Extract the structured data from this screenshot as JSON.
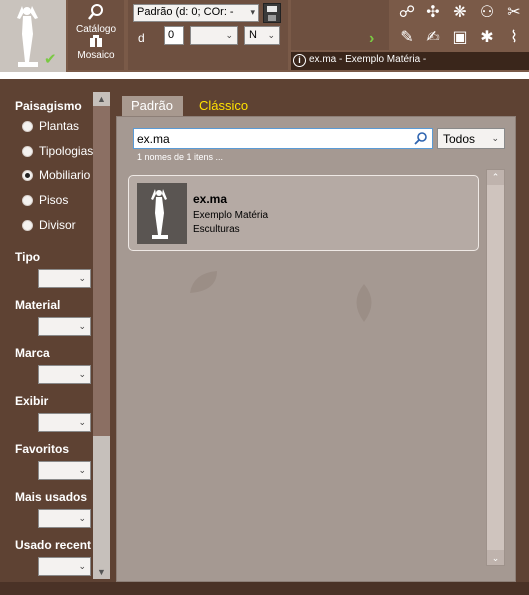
{
  "toolbar": {
    "catalog_label": "Catálogo",
    "mosaic_label": "Mosaico",
    "style_select": "Padrão (d: 0; COr: -",
    "d_label": "d",
    "d_value": "0",
    "n_value": "N",
    "info_text": "ex.ma - Exemplo Matéria -"
  },
  "sidebar": {
    "paisagismo_title": "Paisagismo",
    "radios": [
      {
        "label": "Plantas",
        "checked": false
      },
      {
        "label": "Tipologias",
        "checked": false
      },
      {
        "label": "Mobiliario",
        "checked": true
      },
      {
        "label": "Pisos",
        "checked": false
      },
      {
        "label": "Divisor",
        "checked": false
      }
    ],
    "filters": [
      "Tipo",
      "Material",
      "Marca",
      "Exibir",
      "Favoritos",
      "Mais usados",
      "Usado recent"
    ]
  },
  "tabs": [
    {
      "label": "Padrão",
      "active": true
    },
    {
      "label": "Clássico",
      "active": false
    }
  ],
  "search": {
    "value": "ex.ma",
    "filter": "Todos",
    "count_text": "1 nomes de 1 itens ..."
  },
  "results": [
    {
      "title": "ex.ma",
      "subtitle": "Exemplo Matéria",
      "category": "Esculturas"
    }
  ],
  "colors": {
    "accent_yellow": "#ffe100",
    "check_green": "#7ac943",
    "panel_brown": "#5e4233"
  }
}
